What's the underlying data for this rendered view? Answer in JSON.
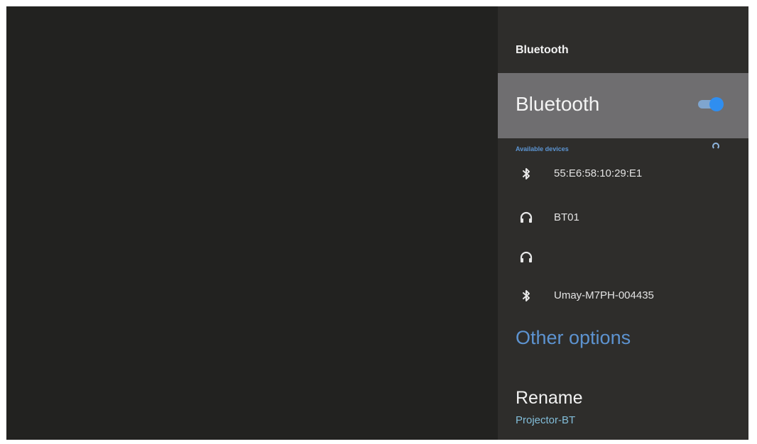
{
  "panel": {
    "title": "Bluetooth"
  },
  "bluetooth_toggle": {
    "label": "Bluetooth",
    "enabled": true,
    "accent_color": "#2f8ef0"
  },
  "available_devices": {
    "header": "Available devices",
    "scanning": true,
    "devices": [
      {
        "icon": "bluetooth-icon",
        "name": "55:E6:58:10:29:E1"
      },
      {
        "icon": "headphones-icon",
        "name": "BT01"
      },
      {
        "icon": "headphones-icon",
        "name": ""
      },
      {
        "icon": "bluetooth-icon",
        "name": "Umay-M7PH-004435"
      }
    ]
  },
  "other_options": {
    "header": "Other options",
    "rename": {
      "label": "Rename",
      "value": "Projector-BT"
    }
  },
  "colors": {
    "section_header": "#5c95d3",
    "rename_value": "#82bdd9",
    "selected_row": "#6f6e70"
  }
}
